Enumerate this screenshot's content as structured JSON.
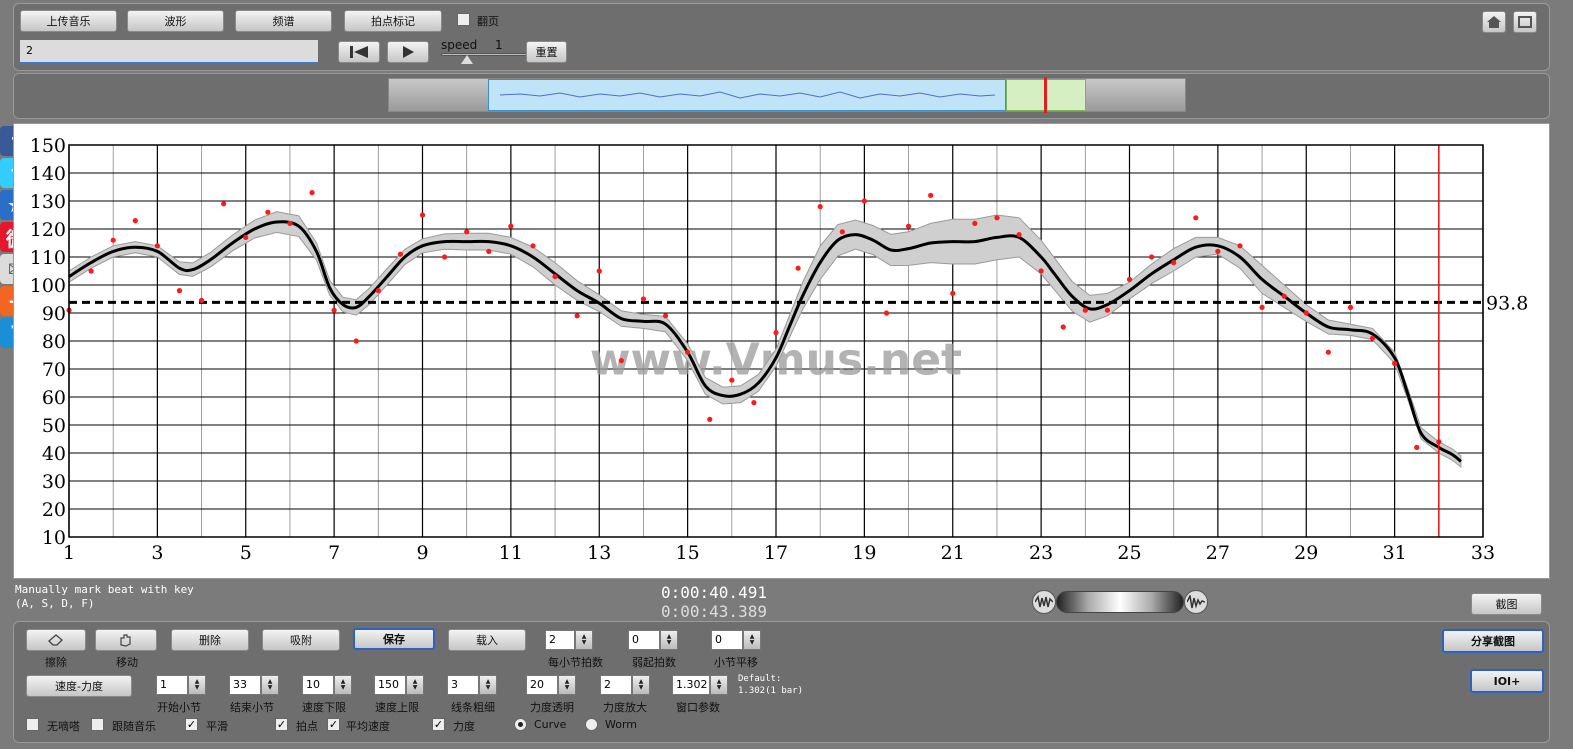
{
  "toolbar": {
    "upload_label": "上传音乐",
    "waveform_label": "波形",
    "spectrum_label": "频谱",
    "beat_mark_label": "拍点标记",
    "page_flip_label": "翻页",
    "input_value": "2",
    "speed_label": "speed",
    "speed_value": "1",
    "reset_label": "重置"
  },
  "status": {
    "hint_line1": "Manually mark beat with key",
    "hint_line2": "(A, S, D, F)",
    "time_current": "0:00:40.491",
    "time_total": "0:00:43.389",
    "screenshot_label": "截图"
  },
  "controls": {
    "erase_label": "擦除",
    "move_label": "移动",
    "delete_label": "删除",
    "snap_label": "吸附",
    "save_label": "保存",
    "load_label": "载入",
    "beats_per_bar": {
      "label": "每小节拍数",
      "value": "2"
    },
    "pickup_beats": {
      "label": "弱起拍数",
      "value": "0"
    },
    "bar_shift": {
      "label": "小节平移",
      "value": "0"
    },
    "tempo_dynamics_label": "速度-力度",
    "start_bar": {
      "label": "开始小节",
      "value": "1"
    },
    "end_bar": {
      "label": "结束小节",
      "value": "33"
    },
    "tempo_min": {
      "label": "速度下限",
      "value": "10"
    },
    "tempo_max": {
      "label": "速度上限",
      "value": "150"
    },
    "line_width": {
      "label": "线条粗细",
      "value": "3"
    },
    "dyn_opacity": {
      "label": "力度透明",
      "value": "20"
    },
    "dyn_scale": {
      "label": "力度放大",
      "value": "2"
    },
    "window_param": {
      "label": "窗口参数",
      "value": "1.302"
    },
    "default_line1": "Default:",
    "default_line2": "1.302(1 bar)",
    "checks": {
      "no_beep": "无嘀嗒",
      "follow_music": "跟随音乐",
      "smooth": "平滑",
      "beat_points": "拍点",
      "avg_tempo": "平均速度",
      "dynamics": "力度"
    },
    "radio_curve": "Curve",
    "radio_worm": "Worm",
    "share_label": "分享截图",
    "ioi_label": "IOI+"
  },
  "icons": {
    "home": "home-icon",
    "fullscreen": "fullscreen-icon",
    "prev": "skip-back-icon",
    "play": "play-icon",
    "wave_left": "waveform-icon",
    "wave_right": "waveform-fade-icon"
  },
  "social": [
    {
      "name": "facebook-icon",
      "color": "#3b5998",
      "glyph": "f"
    },
    {
      "name": "twitter-icon",
      "color": "#33ccff",
      "glyph": "t"
    },
    {
      "name": "favorite-star-icon",
      "color": "#2a6fc7",
      "glyph": "★"
    },
    {
      "name": "weibo-icon",
      "color": "#e6162d",
      "glyph": "微"
    },
    {
      "name": "mail-icon",
      "color": "#dcdcdc",
      "glyph": "✉"
    },
    {
      "name": "share-plus-icon",
      "color": "#f26522",
      "glyph": "+"
    },
    {
      "name": "help-icon",
      "color": "#1b8fd6",
      "glyph": "?"
    }
  ],
  "chart_data": {
    "type": "line",
    "watermark": "www.Vmus.net",
    "xlim": [
      1,
      33
    ],
    "ylim": [
      10,
      150
    ],
    "x_ticks": [
      "1",
      "3",
      "5",
      "7",
      "9",
      "11",
      "13",
      "15",
      "17",
      "19",
      "21",
      "23",
      "25",
      "27",
      "29",
      "31",
      "33"
    ],
    "y_ticks": [
      "10",
      "20",
      "30",
      "40",
      "50",
      "60",
      "70",
      "80",
      "90",
      "100",
      "110",
      "120",
      "130",
      "140",
      "150"
    ],
    "average": 93.8,
    "average_label": "93.8",
    "playhead_x": 32.0,
    "grid": true,
    "smooth_curve": [
      [
        1,
        103
      ],
      [
        1.5,
        108
      ],
      [
        2,
        112
      ],
      [
        2.5,
        113.5
      ],
      [
        3,
        112
      ],
      [
        3.5,
        106
      ],
      [
        3.8,
        105.5
      ],
      [
        4.2,
        109
      ],
      [
        4.7,
        115
      ],
      [
        5.2,
        120
      ],
      [
        5.7,
        122.5
      ],
      [
        6.2,
        121
      ],
      [
        6.6,
        112
      ],
      [
        6.9,
        99
      ],
      [
        7.2,
        93
      ],
      [
        7.5,
        92
      ],
      [
        7.8,
        96
      ],
      [
        8.2,
        103
      ],
      [
        8.6,
        110
      ],
      [
        9,
        114
      ],
      [
        9.5,
        115.5
      ],
      [
        10,
        115.5
      ],
      [
        10.5,
        115.5
      ],
      [
        11,
        114
      ],
      [
        11.5,
        110
      ],
      [
        12,
        104
      ],
      [
        12.5,
        98
      ],
      [
        13,
        93.5
      ],
      [
        13.5,
        88
      ],
      [
        14,
        87
      ],
      [
        14.5,
        86
      ],
      [
        15,
        76
      ],
      [
        15.4,
        64
      ],
      [
        15.8,
        60.5
      ],
      [
        16.2,
        61
      ],
      [
        16.6,
        65
      ],
      [
        17,
        74
      ],
      [
        17.3,
        85
      ],
      [
        17.6,
        96
      ],
      [
        18,
        108
      ],
      [
        18.4,
        116
      ],
      [
        18.8,
        118
      ],
      [
        19.2,
        116
      ],
      [
        19.6,
        112.5
      ],
      [
        20,
        113
      ],
      [
        20.5,
        115
      ],
      [
        21,
        115.5
      ],
      [
        21.5,
        115.5
      ],
      [
        22,
        117
      ],
      [
        22.5,
        117
      ],
      [
        23,
        110
      ],
      [
        23.3,
        104
      ],
      [
        23.7,
        96
      ],
      [
        24.1,
        91.5
      ],
      [
        24.5,
        93
      ],
      [
        25,
        98
      ],
      [
        25.5,
        104
      ],
      [
        26,
        109
      ],
      [
        26.5,
        113.5
      ],
      [
        27,
        114
      ],
      [
        27.5,
        110
      ],
      [
        28,
        102
      ],
      [
        28.5,
        96
      ],
      [
        29,
        90
      ],
      [
        29.5,
        85
      ],
      [
        30,
        84
      ],
      [
        30.5,
        82.5
      ],
      [
        31,
        74
      ],
      [
        31.3,
        61
      ],
      [
        31.6,
        47
      ],
      [
        32,
        42
      ],
      [
        32.3,
        39.5
      ],
      [
        32.5,
        37
      ]
    ],
    "beat_points": [
      [
        1,
        91
      ],
      [
        1.5,
        105
      ],
      [
        2,
        116
      ],
      [
        2.5,
        123
      ],
      [
        3,
        114
      ],
      [
        3.5,
        98
      ],
      [
        4,
        94.5
      ],
      [
        4.5,
        129
      ],
      [
        5,
        117
      ],
      [
        5.5,
        126
      ],
      [
        6,
        122
      ],
      [
        6.5,
        133
      ],
      [
        7,
        91
      ],
      [
        7.5,
        80
      ],
      [
        8,
        98
      ],
      [
        8.5,
        111
      ],
      [
        9,
        125
      ],
      [
        9.5,
        110
      ],
      [
        10,
        119
      ],
      [
        10.5,
        112
      ],
      [
        11,
        121
      ],
      [
        11.5,
        114
      ],
      [
        12,
        103
      ],
      [
        12.5,
        89
      ],
      [
        13,
        105
      ],
      [
        13.5,
        73
      ],
      [
        14,
        95
      ],
      [
        14.5,
        89
      ],
      [
        15,
        76
      ],
      [
        15.5,
        52
      ],
      [
        16,
        66
      ],
      [
        16.5,
        58
      ],
      [
        17,
        83
      ],
      [
        17.5,
        106
      ],
      [
        18,
        128
      ],
      [
        18.5,
        119
      ],
      [
        19,
        130
      ],
      [
        19.5,
        90
      ],
      [
        20,
        121
      ],
      [
        20.5,
        132
      ],
      [
        21,
        97
      ],
      [
        21.5,
        122
      ],
      [
        22,
        124
      ],
      [
        22.5,
        118
      ],
      [
        23,
        105
      ],
      [
        23.5,
        85
      ],
      [
        24,
        91
      ],
      [
        24.5,
        91
      ],
      [
        25,
        102
      ],
      [
        25.5,
        110
      ],
      [
        26,
        108
      ],
      [
        26.5,
        124
      ],
      [
        27,
        112
      ],
      [
        27.5,
        114
      ],
      [
        28,
        92
      ],
      [
        28.5,
        96
      ],
      [
        29,
        90
      ],
      [
        29.5,
        76
      ],
      [
        30,
        92
      ],
      [
        30.5,
        81
      ],
      [
        31,
        72
      ],
      [
        31.5,
        42
      ],
      [
        32,
        44
      ]
    ],
    "band_halfwidth": [
      [
        1,
        2
      ],
      [
        2,
        2
      ],
      [
        3,
        2
      ],
      [
        4,
        2.5
      ],
      [
        5,
        3
      ],
      [
        6,
        4
      ],
      [
        7,
        2.5
      ],
      [
        8,
        3
      ],
      [
        9,
        2.5
      ],
      [
        10,
        3
      ],
      [
        11,
        3
      ],
      [
        12,
        4
      ],
      [
        13,
        3
      ],
      [
        14,
        2.5
      ],
      [
        15,
        3
      ],
      [
        16,
        3
      ],
      [
        17,
        3
      ],
      [
        18,
        6
      ],
      [
        19,
        5
      ],
      [
        20,
        6
      ],
      [
        21,
        8
      ],
      [
        22,
        8
      ],
      [
        23,
        6
      ],
      [
        24,
        5
      ],
      [
        25,
        3
      ],
      [
        26,
        4
      ],
      [
        27,
        3
      ],
      [
        28,
        5
      ],
      [
        29,
        3
      ],
      [
        30,
        2
      ],
      [
        31,
        2
      ],
      [
        32,
        2
      ],
      [
        32.5,
        2
      ]
    ]
  }
}
